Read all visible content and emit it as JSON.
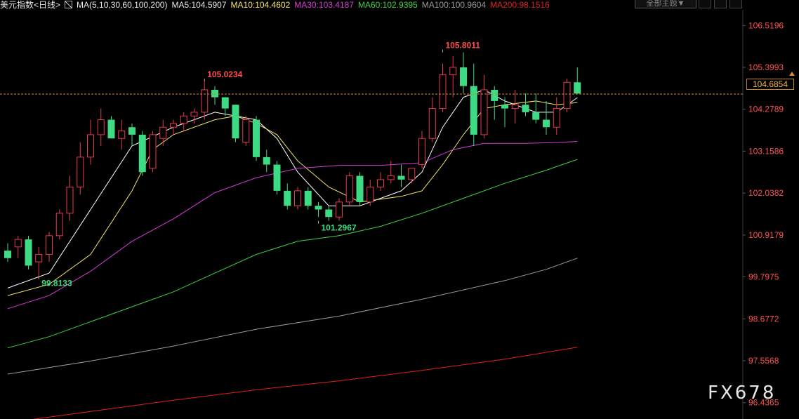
{
  "header": {
    "symbol": "美元指数<日线>",
    "ma_params": "MA(5,10,30,60,100,200)",
    "ma5": "MA5:104.5907",
    "ma10": "MA10:104.4602",
    "ma30": "MA30:103.4187",
    "ma60": "MA60:102.9395",
    "ma100": "MA100:100.9604",
    "ma200": "MA200:98.1516"
  },
  "toolbar": {
    "theme_label": "全部主题▼"
  },
  "watermark": "FX678",
  "last_price_label": "104.6854",
  "colors": {
    "background": "#000000",
    "up": "#e8384f",
    "down": "#3ddc84",
    "ma5": "#ffffff",
    "ma10": "#f5e663",
    "ma30": "#d63bd6",
    "ma60": "#3fd23f",
    "ma100": "#9a9a9a",
    "ma200": "#e02020",
    "axis_text": "#ff5050",
    "last_price_line": "#d88a2e",
    "high_label": "#ff4d4d",
    "low_label": "#3ddc84"
  },
  "chart_data": {
    "type": "candlestick",
    "y_ticks": [
      "106.5196",
      "105.3993",
      "104.2789",
      "103.1586",
      "102.0382",
      "100.9179",
      "99.7975",
      "98.6772",
      "97.5568",
      "96.4365"
    ],
    "ylim": [
      96.0,
      106.9
    ],
    "last_price": 104.6854,
    "annotations": [
      {
        "text": "99.8133",
        "index": 3,
        "value": 99.8133,
        "kind": "low"
      },
      {
        "text": "105.0234",
        "index": 19,
        "value": 105.0234,
        "kind": "high"
      },
      {
        "text": "101.2967",
        "index": 30,
        "value": 101.2967,
        "kind": "low"
      },
      {
        "text": "105.8011",
        "index": 42,
        "value": 105.8011,
        "kind": "high"
      }
    ],
    "candles": [
      [
        100.5,
        100.7,
        100.2,
        100.3
      ],
      [
        100.6,
        100.9,
        100.3,
        100.8
      ],
      [
        100.8,
        100.9,
        100.0,
        100.1
      ],
      [
        100.2,
        100.6,
        99.81,
        100.4
      ],
      [
        100.4,
        101.0,
        100.2,
        100.9
      ],
      [
        100.9,
        101.6,
        100.8,
        101.5
      ],
      [
        101.5,
        102.5,
        101.3,
        102.2
      ],
      [
        102.2,
        103.4,
        102.0,
        103.0
      ],
      [
        103.0,
        104.0,
        102.8,
        103.6
      ],
      [
        103.6,
        104.3,
        103.3,
        104.0
      ],
      [
        104.0,
        104.1,
        103.5,
        103.5
      ],
      [
        103.5,
        104.0,
        103.2,
        103.7
      ],
      [
        103.8,
        103.9,
        103.3,
        103.6
      ],
      [
        103.6,
        103.7,
        102.5,
        102.6
      ],
      [
        102.7,
        103.7,
        102.6,
        103.6
      ],
      [
        103.5,
        104.0,
        103.3,
        103.8
      ],
      [
        103.8,
        104.0,
        103.6,
        103.9
      ],
      [
        103.9,
        104.2,
        103.7,
        104.1
      ],
      [
        104.1,
        104.3,
        103.9,
        104.2
      ],
      [
        104.2,
        105.02,
        104.0,
        104.8
      ],
      [
        104.8,
        104.9,
        104.4,
        104.6
      ],
      [
        104.6,
        104.6,
        104.1,
        104.3
      ],
      [
        104.4,
        104.4,
        103.4,
        103.5
      ],
      [
        103.4,
        104.1,
        103.3,
        104.0
      ],
      [
        104.0,
        104.1,
        102.9,
        103.0
      ],
      [
        103.0,
        103.2,
        102.6,
        102.8
      ],
      [
        102.8,
        102.9,
        102.0,
        102.1
      ],
      [
        102.1,
        102.3,
        101.6,
        101.7
      ],
      [
        101.7,
        102.2,
        101.6,
        102.1
      ],
      [
        102.1,
        102.2,
        101.6,
        101.7
      ],
      [
        101.7,
        101.8,
        101.4,
        101.6
      ],
      [
        101.6,
        101.7,
        101.3,
        101.4
      ],
      [
        101.4,
        101.9,
        101.3,
        101.8
      ],
      [
        101.8,
        102.6,
        101.7,
        102.5
      ],
      [
        102.5,
        102.6,
        101.7,
        101.8
      ],
      [
        101.8,
        102.4,
        101.7,
        102.2
      ],
      [
        102.2,
        102.6,
        102.1,
        102.4
      ],
      [
        102.4,
        102.9,
        102.3,
        102.5
      ],
      [
        102.5,
        102.8,
        102.2,
        102.4
      ],
      [
        102.4,
        102.7,
        102.3,
        102.7
      ],
      [
        102.8,
        103.7,
        102.7,
        103.5
      ],
      [
        103.5,
        104.6,
        103.4,
        104.3
      ],
      [
        104.3,
        105.5,
        104.2,
        105.2
      ],
      [
        105.2,
        105.7,
        104.6,
        105.4
      ],
      [
        105.4,
        105.8,
        104.7,
        104.9
      ],
      [
        104.9,
        105.5,
        103.3,
        103.6
      ],
      [
        103.6,
        105.2,
        103.5,
        104.8
      ],
      [
        104.8,
        104.9,
        104.0,
        104.5
      ],
      [
        104.4,
        104.6,
        103.8,
        104.3
      ],
      [
        104.3,
        104.8,
        103.9,
        104.4
      ],
      [
        104.4,
        104.7,
        104.1,
        104.2
      ],
      [
        104.2,
        104.7,
        103.9,
        104.0
      ],
      [
        104.0,
        104.5,
        103.6,
        103.8
      ],
      [
        103.8,
        104.6,
        103.6,
        104.3
      ],
      [
        104.3,
        105.1,
        104.2,
        105.0
      ],
      [
        105.0,
        105.4,
        104.7,
        104.7
      ]
    ],
    "ma_lines": [
      {
        "name": "MA5",
        "points": [
          [
            0,
            99.5
          ],
          [
            4,
            99.9
          ],
          [
            8,
            101.6
          ],
          [
            12,
            103.3
          ],
          [
            16,
            103.8
          ],
          [
            20,
            104.2
          ],
          [
            24,
            104.0
          ],
          [
            26,
            103.5
          ],
          [
            28,
            102.6
          ],
          [
            31,
            101.7
          ],
          [
            34,
            101.7
          ],
          [
            38,
            102.1
          ],
          [
            40,
            102.6
          ],
          [
            42,
            103.8
          ],
          [
            44,
            104.6
          ],
          [
            46,
            104.8
          ],
          [
            48,
            104.5
          ],
          [
            51,
            104.2
          ],
          [
            53,
            104.2
          ],
          [
            55,
            104.59
          ]
        ]
      },
      {
        "name": "MA10",
        "points": [
          [
            0,
            99.3
          ],
          [
            4,
            99.6
          ],
          [
            8,
            100.4
          ],
          [
            12,
            102.1
          ],
          [
            14,
            103.2
          ],
          [
            16,
            103.6
          ],
          [
            20,
            104.0
          ],
          [
            22,
            104.1
          ],
          [
            24,
            103.9
          ],
          [
            26,
            103.6
          ],
          [
            28,
            102.9
          ],
          [
            31,
            102.2
          ],
          [
            34,
            101.8
          ],
          [
            38,
            101.95
          ],
          [
            40,
            102.1
          ],
          [
            42,
            102.8
          ],
          [
            44,
            103.6
          ],
          [
            46,
            104.3
          ],
          [
            48,
            104.4
          ],
          [
            51,
            104.5
          ],
          [
            53,
            104.4
          ],
          [
            55,
            104.46
          ]
        ]
      },
      {
        "name": "MA30",
        "points": [
          [
            0,
            98.95
          ],
          [
            4,
            99.3
          ],
          [
            8,
            99.95
          ],
          [
            12,
            100.75
          ],
          [
            16,
            101.35
          ],
          [
            20,
            102.05
          ],
          [
            24,
            102.45
          ],
          [
            28,
            102.7
          ],
          [
            32,
            102.78
          ],
          [
            36,
            102.78
          ],
          [
            40,
            102.85
          ],
          [
            43,
            103.2
          ],
          [
            46,
            103.37
          ],
          [
            50,
            103.37
          ],
          [
            53,
            103.39
          ],
          [
            55,
            103.42
          ]
        ]
      },
      {
        "name": "MA60",
        "points": [
          [
            0,
            97.9
          ],
          [
            4,
            98.2
          ],
          [
            8,
            98.6
          ],
          [
            12,
            99.0
          ],
          [
            16,
            99.4
          ],
          [
            20,
            99.9
          ],
          [
            24,
            100.4
          ],
          [
            28,
            100.75
          ],
          [
            32,
            100.9
          ],
          [
            36,
            101.15
          ],
          [
            40,
            101.5
          ],
          [
            44,
            101.9
          ],
          [
            48,
            102.3
          ],
          [
            52,
            102.65
          ],
          [
            55,
            102.94
          ]
        ]
      },
      {
        "name": "MA100",
        "points": [
          [
            0,
            97.2
          ],
          [
            8,
            97.55
          ],
          [
            16,
            97.95
          ],
          [
            24,
            98.4
          ],
          [
            32,
            98.75
          ],
          [
            40,
            99.2
          ],
          [
            48,
            99.7
          ],
          [
            52,
            100.0
          ],
          [
            55,
            100.3
          ]
        ]
      },
      {
        "name": "MA200",
        "points": [
          [
            0,
            95.9
          ],
          [
            8,
            96.2
          ],
          [
            16,
            96.5
          ],
          [
            24,
            96.78
          ],
          [
            32,
            97.02
          ],
          [
            40,
            97.3
          ],
          [
            48,
            97.6
          ],
          [
            55,
            97.92
          ]
        ]
      }
    ]
  }
}
